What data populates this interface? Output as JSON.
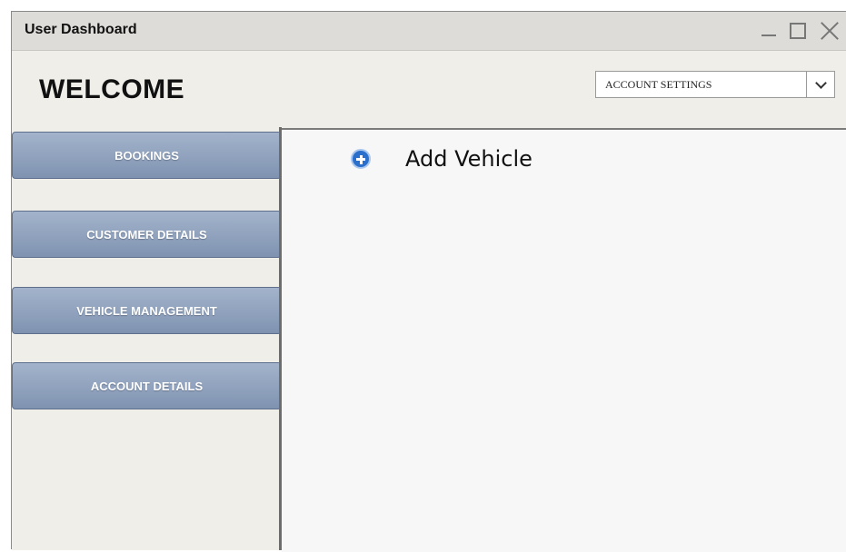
{
  "window": {
    "title": "User Dashboard"
  },
  "header": {
    "welcome": "WELCOME",
    "account_select": {
      "selected": "ACCOUNT SETTINGS"
    }
  },
  "sidebar": {
    "items": [
      {
        "label": "BOOKINGS"
      },
      {
        "label": "CUSTOMER DETAILS"
      },
      {
        "label": "VEHICLE MANAGEMENT"
      },
      {
        "label": "ACCOUNT DETAILS"
      }
    ]
  },
  "main": {
    "add_vehicle": {
      "label": "Add Vehicle",
      "icon": "plus-circle-icon"
    }
  },
  "colors": {
    "nav_button": "#8ea0bd",
    "background": "#efeee9",
    "accent_icon": "#2a6fcc"
  }
}
